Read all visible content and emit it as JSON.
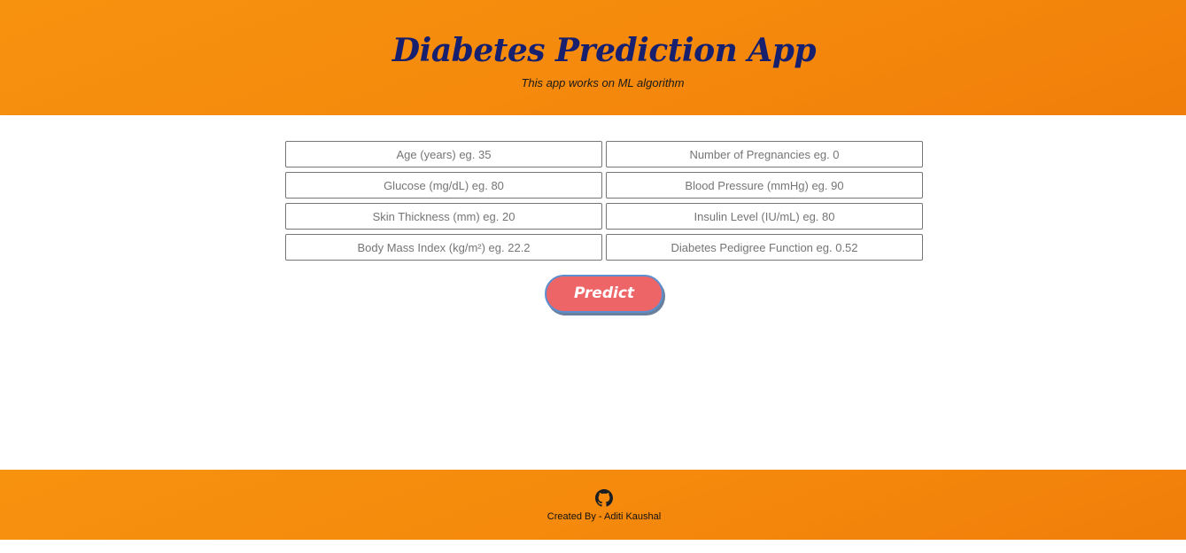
{
  "header": {
    "title": "Diabetes Prediction App",
    "subtitle": "This app works on ML algorithm"
  },
  "form": {
    "fields": [
      {
        "placeholder": "Age (years) eg. 35",
        "value": ""
      },
      {
        "placeholder": "Number of Pregnancies eg. 0",
        "value": ""
      },
      {
        "placeholder": "Glucose (mg/dL) eg. 80",
        "value": ""
      },
      {
        "placeholder": "Blood Pressure (mmHg) eg. 90",
        "value": ""
      },
      {
        "placeholder": "Skin Thickness (mm) eg. 20",
        "value": ""
      },
      {
        "placeholder": "Insulin Level (IU/mL) eg. 80",
        "value": ""
      },
      {
        "placeholder": "Body Mass Index (kg/m²) eg. 22.2",
        "value": ""
      },
      {
        "placeholder": "Diabetes Pedigree Function eg. 0.52",
        "value": ""
      }
    ],
    "submit_label": "Predict"
  },
  "footer": {
    "icon": "github-icon",
    "credit": "Created By - Aditi Kaushal"
  },
  "colors": {
    "header_bg": "#f58a0c",
    "title": "#17206e",
    "button_bg": "#ee6568",
    "button_border": "#5b8fcf"
  }
}
